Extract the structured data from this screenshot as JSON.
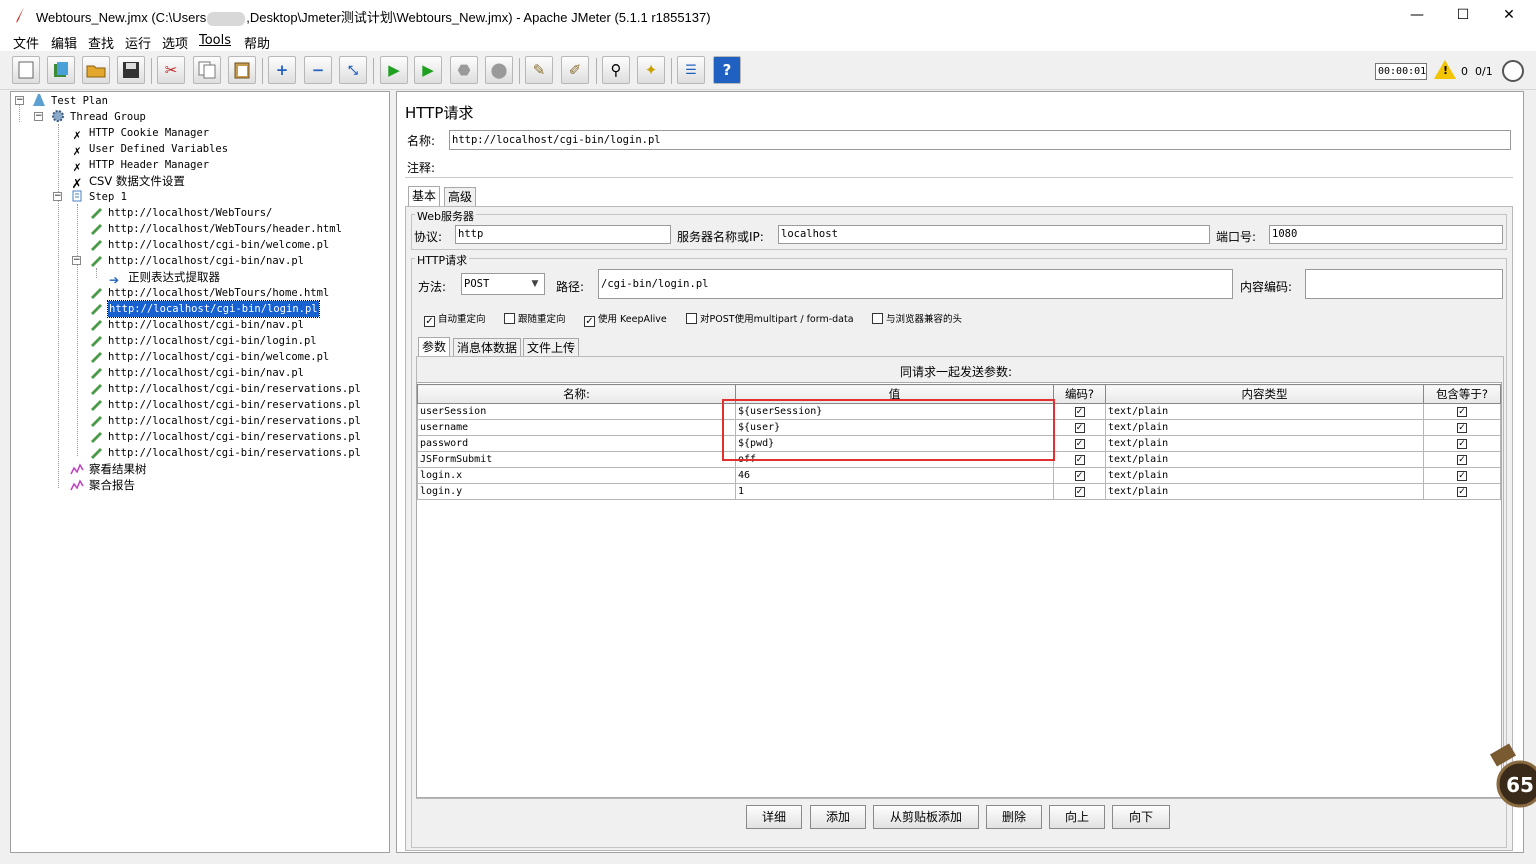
{
  "window": {
    "title_prefix": "Webtours_New.jmx (C:\\Users",
    "title_suffix": ",Desktop\\Jmeter测试计划\\Webtours_New.jmx) - Apache JMeter (5.1.1 r1855137)",
    "min": "—",
    "max": "☐",
    "close": "✕"
  },
  "menu": [
    "文件",
    "编辑",
    "查找",
    "运行",
    "选项",
    "Tools",
    "帮助"
  ],
  "status": {
    "timer": "00:00:01",
    "error_count": "0",
    "threads": "0/1"
  },
  "tree": {
    "test_plan": "Test Plan",
    "thread_group": "Thread Group",
    "cookie": "HTTP Cookie Manager",
    "udv": "User Defined Variables",
    "header": "HTTP Header Manager",
    "csv": "CSV 数据文件设置",
    "step": "Step 1",
    "r1": "http://localhost/WebTours/",
    "r2": "http://localhost/WebTours/header.html",
    "r3": "http://localhost/cgi-bin/welcome.pl",
    "r4": "http://localhost/cgi-bin/nav.pl",
    "regex": "正则表达式提取器",
    "r5": "http://localhost/WebTours/home.html",
    "r6": "http://localhost/cgi-bin/login.pl",
    "r7": "http://localhost/cgi-bin/nav.pl",
    "r8": "http://localhost/cgi-bin/login.pl",
    "r9": "http://localhost/cgi-bin/welcome.pl",
    "r10": "http://localhost/cgi-bin/nav.pl",
    "r11": "http://localhost/cgi-bin/reservations.pl",
    "r12": "http://localhost/cgi-bin/reservations.pl",
    "r13": "http://localhost/cgi-bin/reservations.pl",
    "r14": "http://localhost/cgi-bin/reservations.pl",
    "r15": "http://localhost/cgi-bin/reservations.pl",
    "results_tree": "察看结果树",
    "aggregate": "聚合报告"
  },
  "panel": {
    "title": "HTTP请求",
    "name_label": "名称:",
    "name_value": "http://localhost/cgi-bin/login.pl",
    "comment_label": "注释:",
    "tab_basic": "基本",
    "tab_advanced": "高级",
    "web_server_group": "Web服务器",
    "protocol_label": "协议:",
    "protocol_value": "http",
    "server_label": "服务器名称或IP:",
    "server_value": "localhost",
    "port_label": "端口号:",
    "port_value": "1080",
    "http_request_group": "HTTP请求",
    "method_label": "方法:",
    "method_value": "POST",
    "path_label": "路径:",
    "path_value": "/cgi-bin/login.pl",
    "encoding_label": "内容编码:",
    "encoding_value": "",
    "opt_redirect_auto": "自动重定向",
    "opt_follow_redirects": "跟随重定向",
    "opt_keepalive": "使用 KeepAlive",
    "opt_multipart": "对POST使用multipart / form-data",
    "opt_browser_headers": "与浏览器兼容的头",
    "subtab_params": "参数",
    "subtab_body": "消息体数据",
    "subtab_files": "文件上传",
    "params_caption": "同请求一起发送参数:"
  },
  "table": {
    "headers": [
      "名称:",
      "值",
      "编码?",
      "内容类型",
      "包含等于?"
    ],
    "rows": [
      [
        "userSession",
        "${userSession}",
        "text/plain"
      ],
      [
        "username",
        "${user}",
        "text/plain"
      ],
      [
        "password",
        "${pwd}",
        "text/plain"
      ],
      [
        "JSFormSubmit",
        "off",
        "text/plain"
      ],
      [
        "login.x",
        "46",
        "text/plain"
      ],
      [
        "login.y",
        "1",
        "text/plain"
      ]
    ]
  },
  "buttons": {
    "detail": "详细",
    "add": "添加",
    "add_clipboard": "从剪贴板添加",
    "delete": "删除",
    "up": "向上",
    "down": "向下"
  },
  "badge_text": "65",
  "colors": {
    "selection": "#1660d0",
    "highlight_box": "#e03030",
    "run_green": "#20a020"
  }
}
